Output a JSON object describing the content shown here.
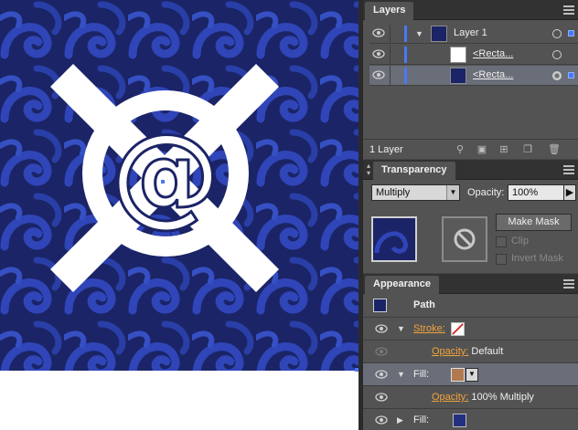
{
  "layers_panel": {
    "tab_label": "Layers",
    "rows": [
      {
        "name": "Layer 1"
      },
      {
        "name": "<Recta..."
      },
      {
        "name": "<Recta..."
      }
    ],
    "footer_count": "1 Layer"
  },
  "transparency_panel": {
    "tab_label": "Transparency",
    "blend_mode": "Multiply",
    "opacity_label": "Opacity:",
    "opacity_value": "100%",
    "make_mask_label": "Make Mask",
    "clip_label": "Clip",
    "invert_mask_label": "Invert Mask"
  },
  "appearance_panel": {
    "tab_label": "Appearance",
    "object_label": "Path",
    "rows": [
      {
        "label": "Stroke:"
      },
      {
        "label": "Opacity:",
        "value": " Default"
      },
      {
        "label": "Fill:"
      },
      {
        "label": "Opacity:",
        "value": " 100% Multiply"
      },
      {
        "label": "Fill:"
      }
    ]
  },
  "colors": {
    "selection_blue": "#4a78f5",
    "pattern_dark": "#1b2466",
    "pattern_light": "#2f45b8",
    "fill_swatch": "#233080",
    "accent_orange": "#f2a23c"
  },
  "icons": [
    "eye-icon",
    "trash-icon",
    "search-icon",
    "new-layer-icon",
    "no-mask-icon",
    "panel-menu-icon"
  ]
}
